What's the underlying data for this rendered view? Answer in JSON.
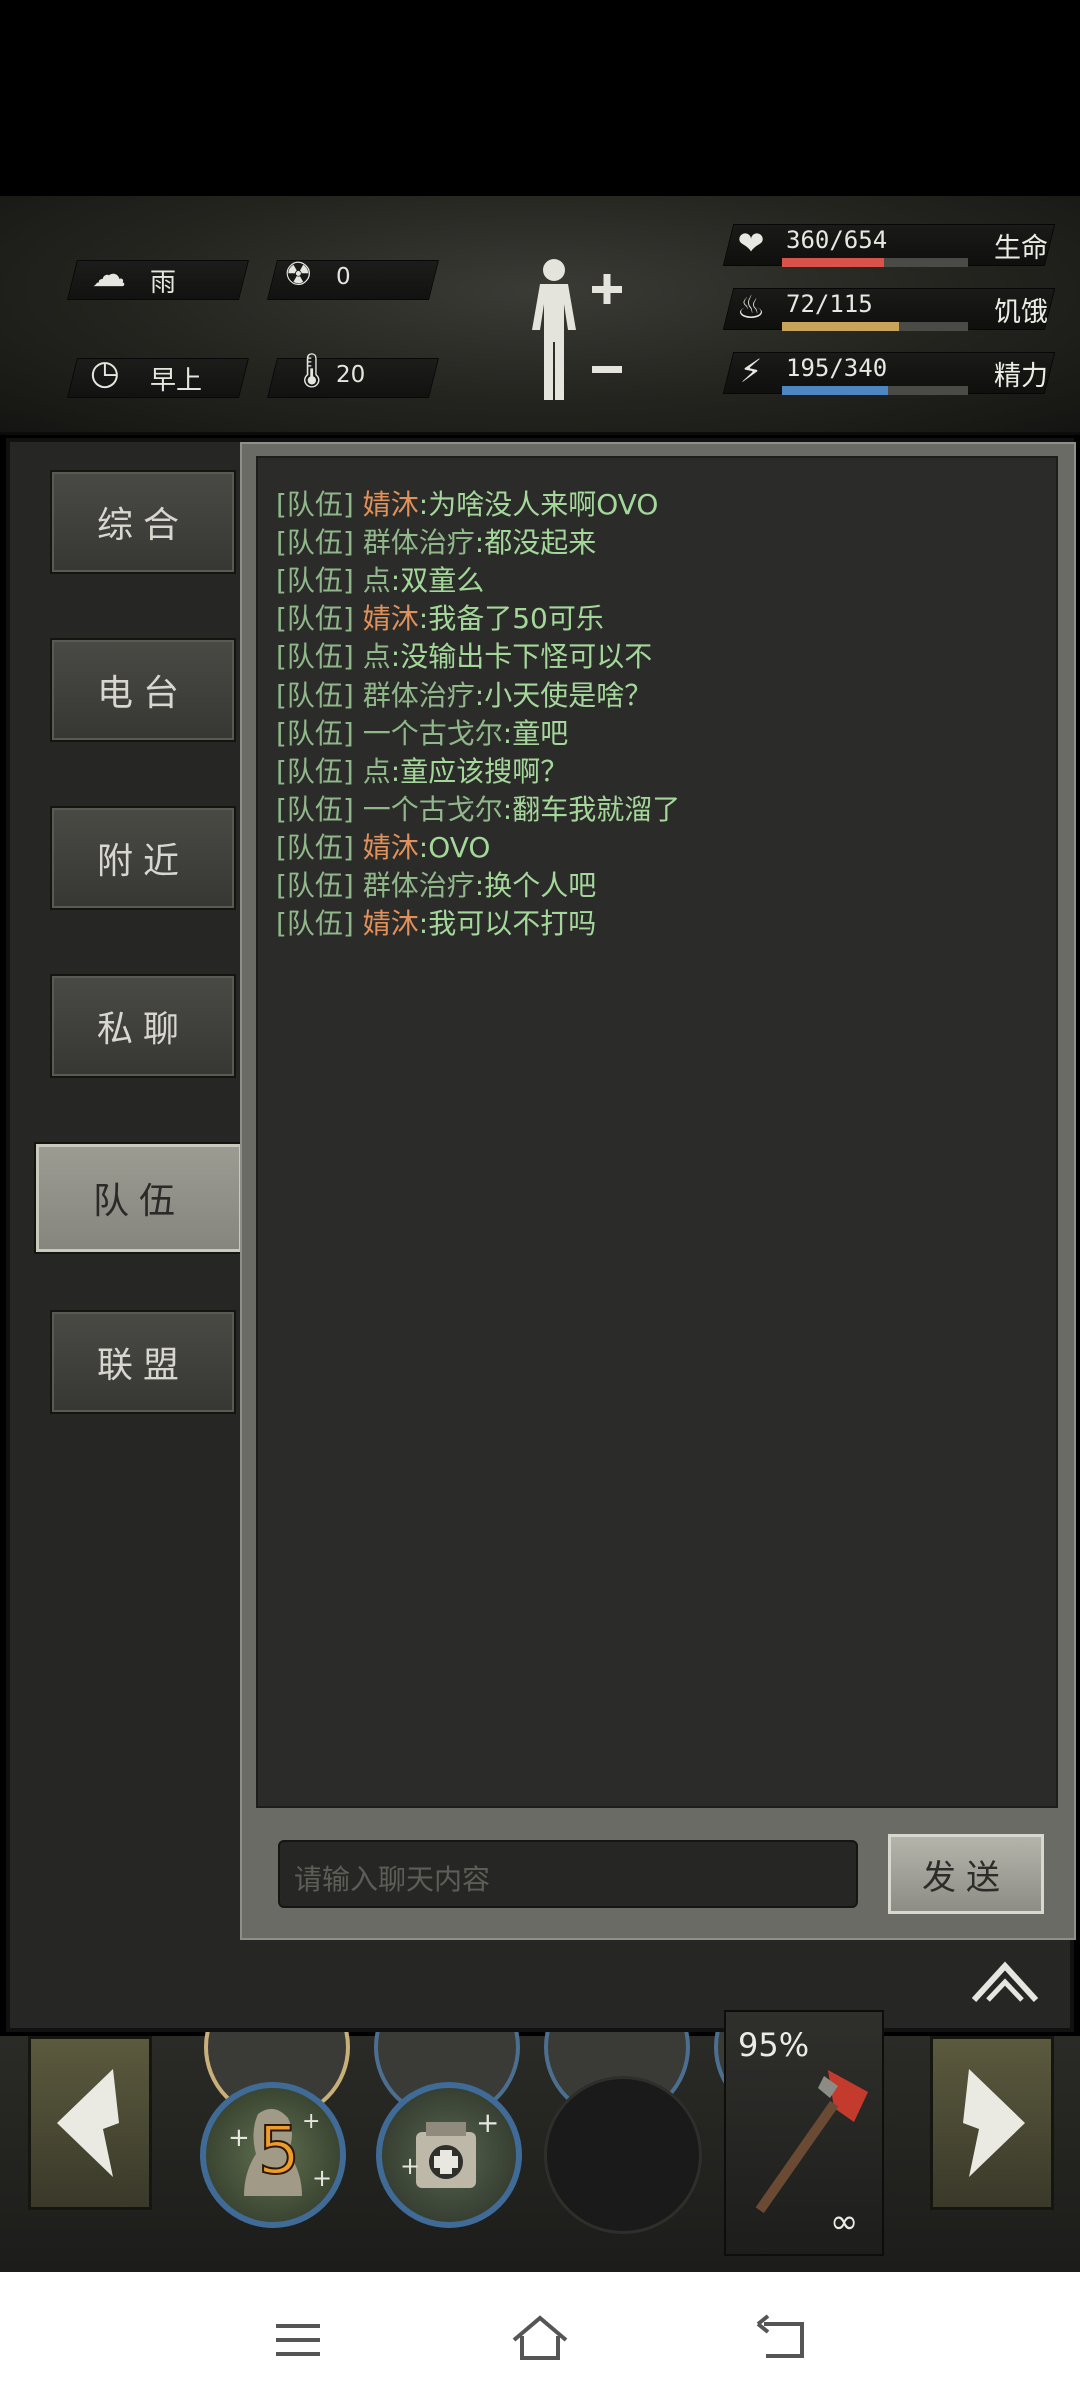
{
  "status": {
    "weather": "雨",
    "radiation": "0",
    "time_of_day": "早上",
    "temperature": "20"
  },
  "stats": {
    "health": {
      "value": "360/654",
      "label": "生命",
      "fraction": 0.55,
      "color": "#d9534a"
    },
    "hunger": {
      "value": "72/115",
      "label": "饥饿",
      "fraction": 0.63,
      "color": "#c9a35a"
    },
    "energy": {
      "value": "195/340",
      "label": "精力",
      "fraction": 0.57,
      "color": "#4d86c0"
    }
  },
  "tabs": [
    {
      "label": "综合",
      "active": false
    },
    {
      "label": "电台",
      "active": false
    },
    {
      "label": "附近",
      "active": false
    },
    {
      "label": "私聊",
      "active": false
    },
    {
      "label": "队伍",
      "active": true
    },
    {
      "label": "联盟",
      "active": false
    }
  ],
  "messages": [
    {
      "channel": "[队伍]",
      "name": "婧沐",
      "orange": true,
      "text": ":为啥没人来啊OVO"
    },
    {
      "channel": "[队伍]",
      "name": "群体治疗",
      "orange": false,
      "text": ":都没起来"
    },
    {
      "channel": "[队伍]",
      "name": "点",
      "orange": false,
      "text": ":双童么"
    },
    {
      "channel": "[队伍]",
      "name": "婧沐",
      "orange": true,
      "text": ":我备了50可乐"
    },
    {
      "channel": "[队伍]",
      "name": "点",
      "orange": false,
      "text": ":没输出卡下怪可以不"
    },
    {
      "channel": "[队伍]",
      "name": "群体治疗",
      "orange": false,
      "text": ":小天使是啥？"
    },
    {
      "channel": "[队伍]",
      "name": "一个古戈尔",
      "orange": false,
      "text": ":童吧"
    },
    {
      "channel": "[队伍]",
      "name": "点",
      "orange": false,
      "text": ":童应该搜啊？"
    },
    {
      "channel": "[队伍]",
      "name": "一个古戈尔",
      "orange": false,
      "text": ":翻车我就溜了"
    },
    {
      "channel": "[队伍]",
      "name": "婧沐",
      "orange": true,
      "text": ":OVO"
    },
    {
      "channel": "[队伍]",
      "name": "群体治疗",
      "orange": false,
      "text": ":换个人吧"
    },
    {
      "channel": "[队伍]",
      "name": "婧沐",
      "orange": true,
      "text": ":我可以不打吗"
    }
  ],
  "input": {
    "placeholder": "请输入聊天内容",
    "value": ""
  },
  "send_label": "发送",
  "action_bar": {
    "skill_count": "5",
    "weapon_durability": "95%",
    "weapon_uses": "∞"
  }
}
